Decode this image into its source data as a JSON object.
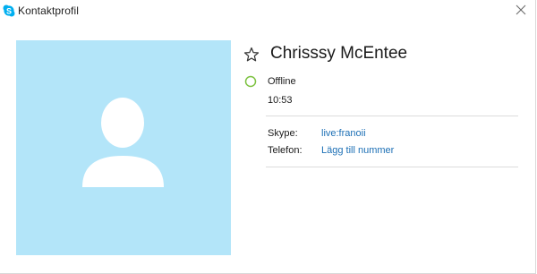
{
  "window": {
    "title": "Kontaktprofil",
    "app_icon": "skype-icon",
    "close_icon": "close-icon"
  },
  "colors": {
    "accent_link": "#1c6fb5",
    "avatar_bg": "#b3e5f9",
    "status_offline": "#7dc241",
    "skype_blue": "#00aff0"
  },
  "profile": {
    "name": "Chrisssy McEntee",
    "favorite_icon": "star-outline-icon",
    "status_icon": "status-offline-icon",
    "status": "Offline",
    "local_time": "10:53",
    "avatar_icon": "default-avatar-icon"
  },
  "details": {
    "skype_label": "Skype:",
    "skype_value": "live:franoii",
    "phone_label": "Telefon:",
    "phone_value": "Lägg till nummer"
  }
}
